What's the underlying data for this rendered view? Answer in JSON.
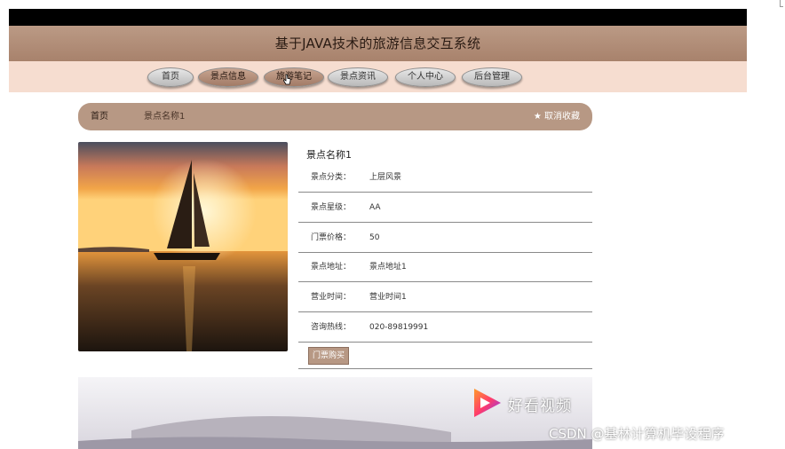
{
  "site": {
    "title": "基于JAVA技术的旅游信息交互系统"
  },
  "nav": {
    "items": [
      "首页",
      "景点信息",
      "旅游笔记",
      "景点资讯",
      "个人中心",
      "后台管理"
    ],
    "active": [
      "景点信息",
      "旅游笔记"
    ]
  },
  "breadcrumb": {
    "home": "首页",
    "current": "景点名称1",
    "favorite": "取消收藏"
  },
  "detail": {
    "name": "景点名称1",
    "fields": [
      {
        "key": "景点分类：",
        "value": "上层风景"
      },
      {
        "key": "景点星级：",
        "value": "AA"
      },
      {
        "key": "门票价格：",
        "value": "50"
      },
      {
        "key": "景点地址：",
        "value": "景点地址1"
      },
      {
        "key": "营业时间：",
        "value": "营业时间1"
      },
      {
        "key": "咨询热线：",
        "value": "020-89819991"
      }
    ],
    "buy_label": "门票购买"
  },
  "watermarks": {
    "video": "好看视频",
    "csdn": "CSDN @基林计算机毕设程序"
  },
  "colors": {
    "brand": "#b79884",
    "header": "#a8826c",
    "nav_bg": "#f6ddd0"
  }
}
